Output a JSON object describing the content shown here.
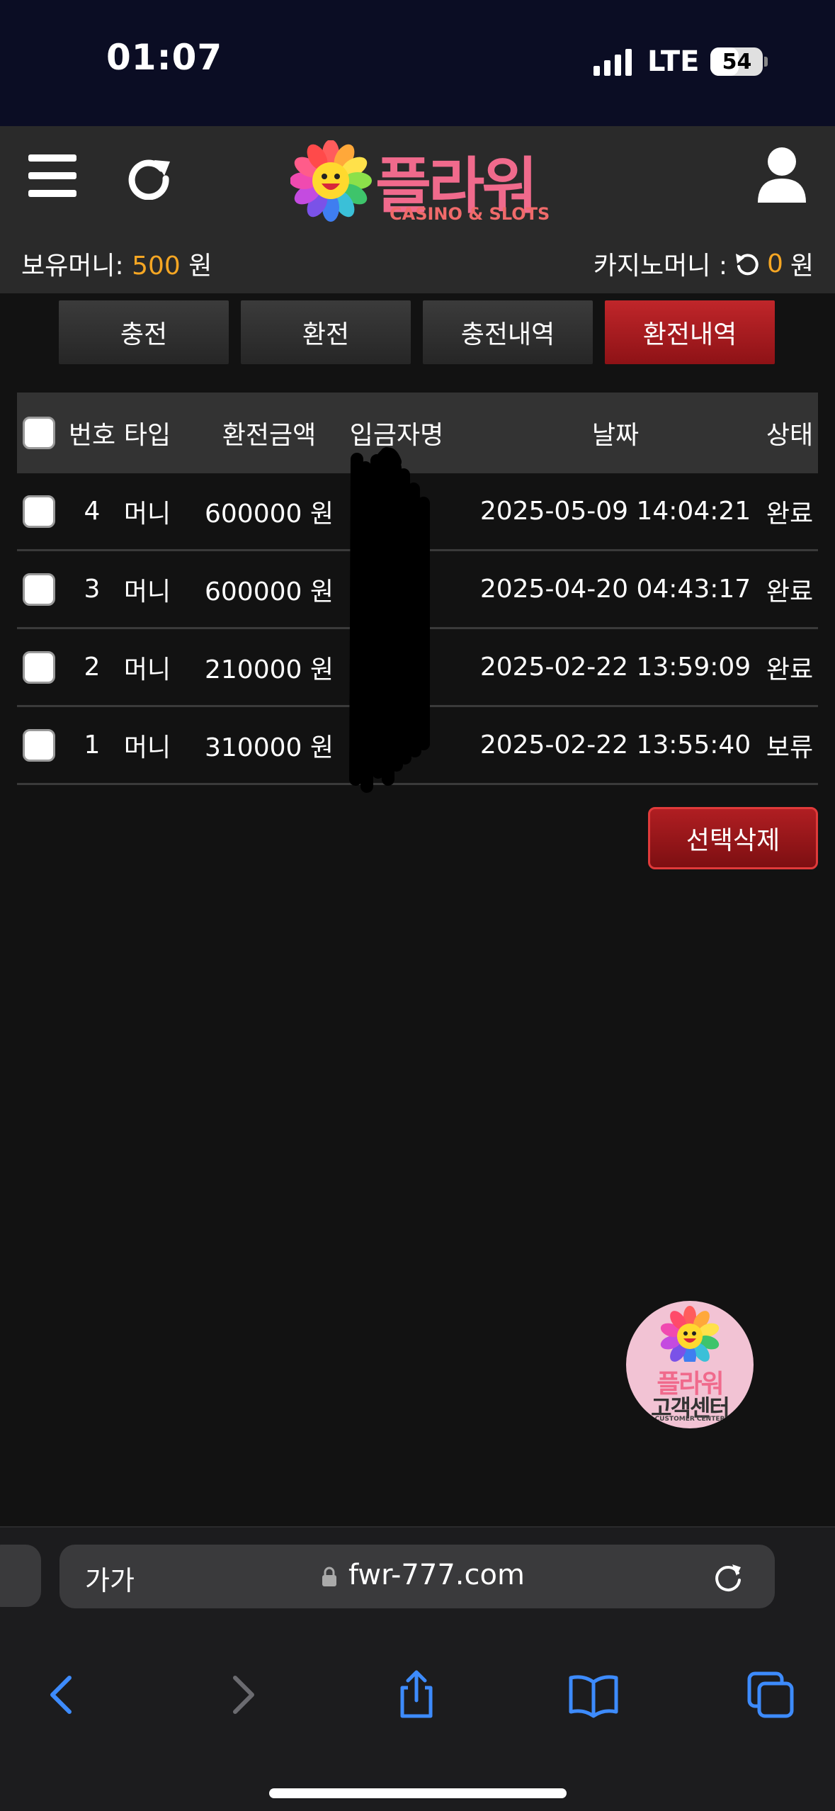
{
  "status_bar": {
    "time": "01:07",
    "network": "LTE",
    "battery": "54"
  },
  "header": {
    "logo_text": "플라워",
    "logo_sub": "CASINO & SLOTS",
    "balance_label": "보유머니:",
    "balance_value": "500",
    "balance_unit": "원",
    "casino_label": "카지노머니 :",
    "casino_value": "0",
    "casino_unit": "원"
  },
  "tabs": [
    {
      "label": "충전",
      "active": false
    },
    {
      "label": "환전",
      "active": false
    },
    {
      "label": "충전내역",
      "active": false
    },
    {
      "label": "환전내역",
      "active": true
    }
  ],
  "table": {
    "columns": [
      "번호",
      "타입",
      "환전금액",
      "입금자명",
      "날짜",
      "상태"
    ],
    "rows": [
      {
        "no": "4",
        "type": "머니",
        "amount": "600000 원",
        "name": "",
        "date": "2025-05-09 14:04:21",
        "status": "완료"
      },
      {
        "no": "3",
        "type": "머니",
        "amount": "600000 원",
        "name": "",
        "date": "2025-04-20 04:43:17",
        "status": "완료"
      },
      {
        "no": "2",
        "type": "머니",
        "amount": "210000 원",
        "name": "",
        "date": "2025-02-22 13:59:09",
        "status": "완료"
      },
      {
        "no": "1",
        "type": "머니",
        "amount": "310000 원",
        "name": "",
        "date": "2025-02-22 13:55:40",
        "status": "보류"
      }
    ]
  },
  "delete_button": "선택삭제",
  "support": {
    "line1": "플라워",
    "line2": "고객센터",
    "line3": "CUSTOMER CENTER"
  },
  "browser": {
    "text_size": "가가",
    "url": "fwr-777.com"
  },
  "colors": {
    "accent_orange": "#f5a623",
    "active_tab": "#c0262a",
    "browser_blue": "#3d8bfd"
  }
}
